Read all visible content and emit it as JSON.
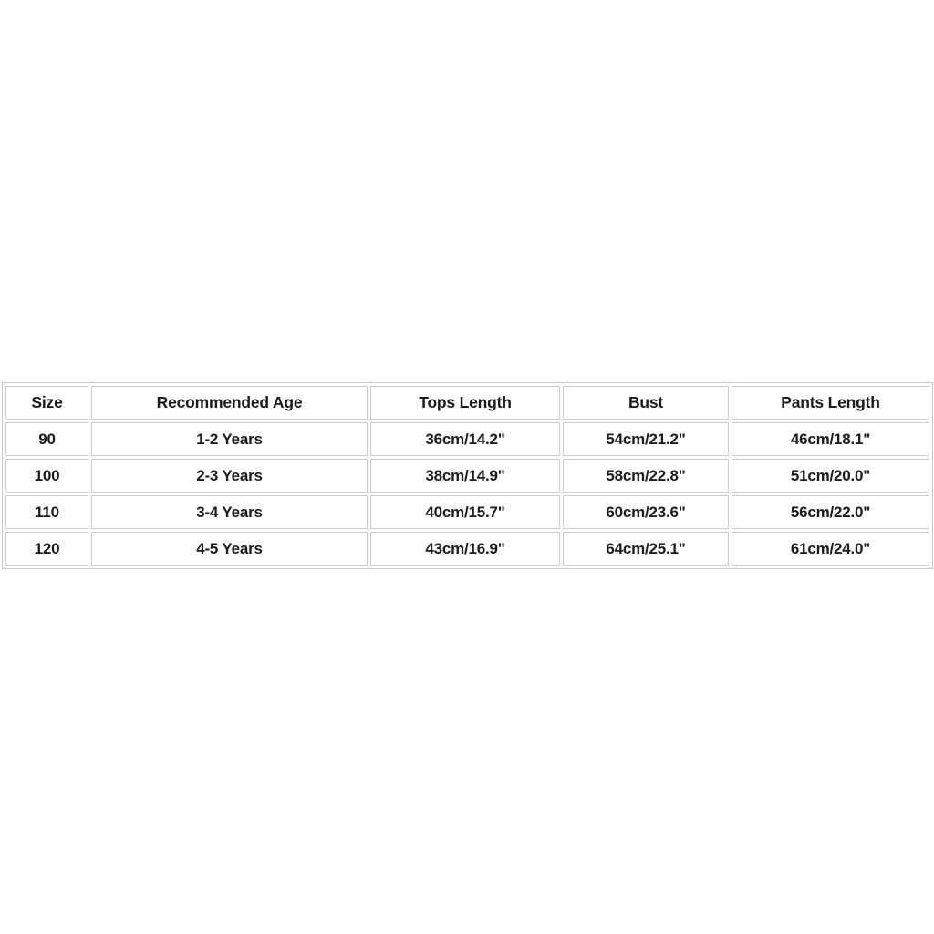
{
  "page": {
    "background_color": "#ffffff",
    "text_color": "#1b1b1b",
    "border_color": "#cccccc"
  },
  "size_chart": {
    "type": "table",
    "columns": [
      "Size",
      "Recommended Age",
      "Tops Length",
      "Bust",
      "Pants Length"
    ],
    "rows": [
      {
        "size": "90",
        "recommended_age": "1-2 Years",
        "tops_length": "36cm/14.2\"",
        "bust": "54cm/21.2\"",
        "pants_length": "46cm/18.1\""
      },
      {
        "size": "100",
        "recommended_age": "2-3 Years",
        "tops_length": "38cm/14.9\"",
        "bust": "58cm/22.8\"",
        "pants_length": "51cm/20.0\""
      },
      {
        "size": "110",
        "recommended_age": "3-4 Years",
        "tops_length": "40cm/15.7\"",
        "bust": "60cm/23.6\"",
        "pants_length": "56cm/22.0\""
      },
      {
        "size": "120",
        "recommended_age": "4-5 Years",
        "tops_length": "43cm/16.9\"",
        "bust": "64cm/25.1\"",
        "pants_length": "61cm/24.0\""
      }
    ]
  }
}
